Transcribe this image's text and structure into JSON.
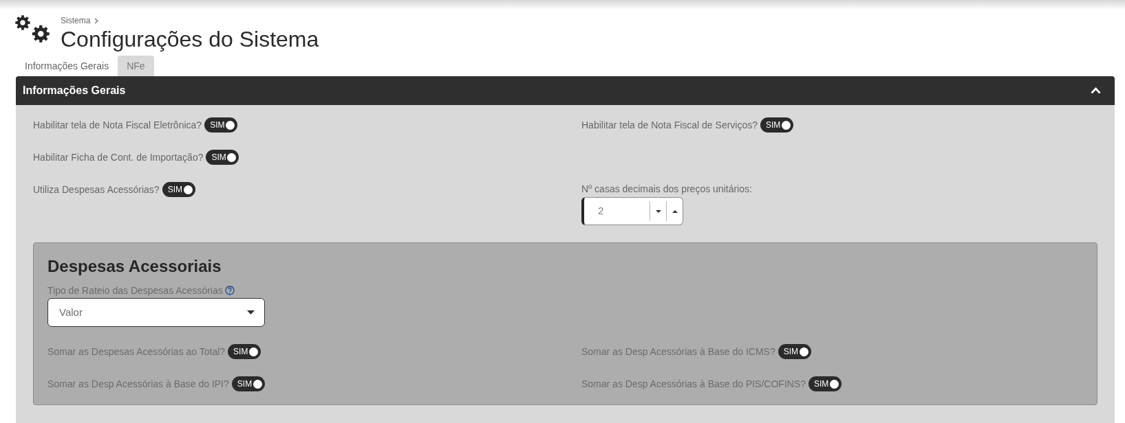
{
  "breadcrumb": [
    {
      "label": "Sistema"
    }
  ],
  "page": {
    "title": "Configurações do Sistema"
  },
  "tabs": [
    {
      "label": "Informações Gerais",
      "selected": false
    },
    {
      "label": "NFe",
      "selected": true
    }
  ],
  "panel": {
    "title": "Informações Gerais",
    "expanded": true,
    "rows": [
      [
        {
          "kind": "toggle",
          "label": "Habilitar tela de Nota Fiscal Eletrônica?",
          "on": true,
          "state_text": "SIM"
        },
        {
          "kind": "toggle",
          "label": "Habilitar tela de Nota Fiscal de Serviços?",
          "on": true,
          "state_text": "SIM"
        }
      ],
      [
        {
          "kind": "toggle",
          "label": "Habilitar Ficha de Cont. de Importação?",
          "on": true,
          "state_text": "SIM"
        }
      ],
      [
        {
          "kind": "toggle",
          "label": "Utiliza Despesas Acessórias?",
          "on": true,
          "state_text": "SIM"
        },
        {
          "kind": "number",
          "label": "Nº casas decimais dos preços unitários:",
          "value": "2"
        }
      ]
    ],
    "section": {
      "title": "Despesas Acessoriais",
      "select": {
        "label": "Tipo de Rateio das Despesas Acessórias",
        "value": "Valor"
      },
      "rows": [
        [
          {
            "kind": "toggle",
            "label": "Somar as Despesas Acessórias ao Total?",
            "on": true,
            "state_text": "SIM"
          },
          {
            "kind": "toggle",
            "label": "Somar as Desp Acessórias à Base do ICMS?",
            "on": true,
            "state_text": "SIM"
          }
        ],
        [
          {
            "kind": "toggle",
            "label": "Somar as Desp Acessórias à Base do IPI?",
            "on": true,
            "state_text": "SIM"
          },
          {
            "kind": "toggle",
            "label": "Somar as Desp Acessórias à Base do PIS/COFINS?",
            "on": true,
            "state_text": "SIM"
          }
        ]
      ]
    }
  }
}
